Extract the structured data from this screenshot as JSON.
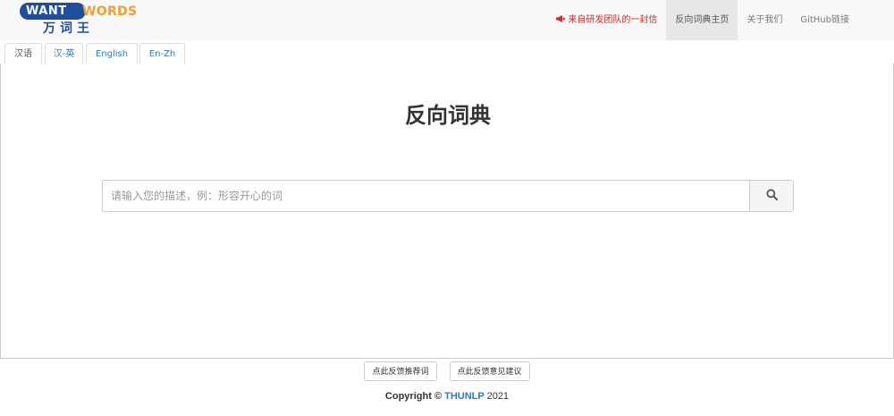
{
  "logo": {
    "want": "WANT",
    "words": "WORDS",
    "chinese": "万词王"
  },
  "nav": {
    "letter_label": "来自研发团队的一封信",
    "home_label": "反向词典主页",
    "about_label": "关于我们",
    "github_label": "GitHub链接",
    "letter_color": "#c9302c"
  },
  "tabs": [
    {
      "label": "汉语"
    },
    {
      "label": "汉-英"
    },
    {
      "label": "English"
    },
    {
      "label": "En-Zh"
    }
  ],
  "main": {
    "title": "反向词典",
    "search_placeholder": "请输入您的描述，例：形容开心的词"
  },
  "footer": {
    "feedback_words": "点此反馈推荐词",
    "feedback_suggestions": "点此反馈意见建议",
    "copyright_prefix": "Copyright ©",
    "copyright_org": "THUNLP",
    "copyright_year": "2021"
  },
  "colors": {
    "brand_blue": "#1f4f9a",
    "brand_orange": "#f0a030",
    "link_blue": "#337ab7"
  }
}
